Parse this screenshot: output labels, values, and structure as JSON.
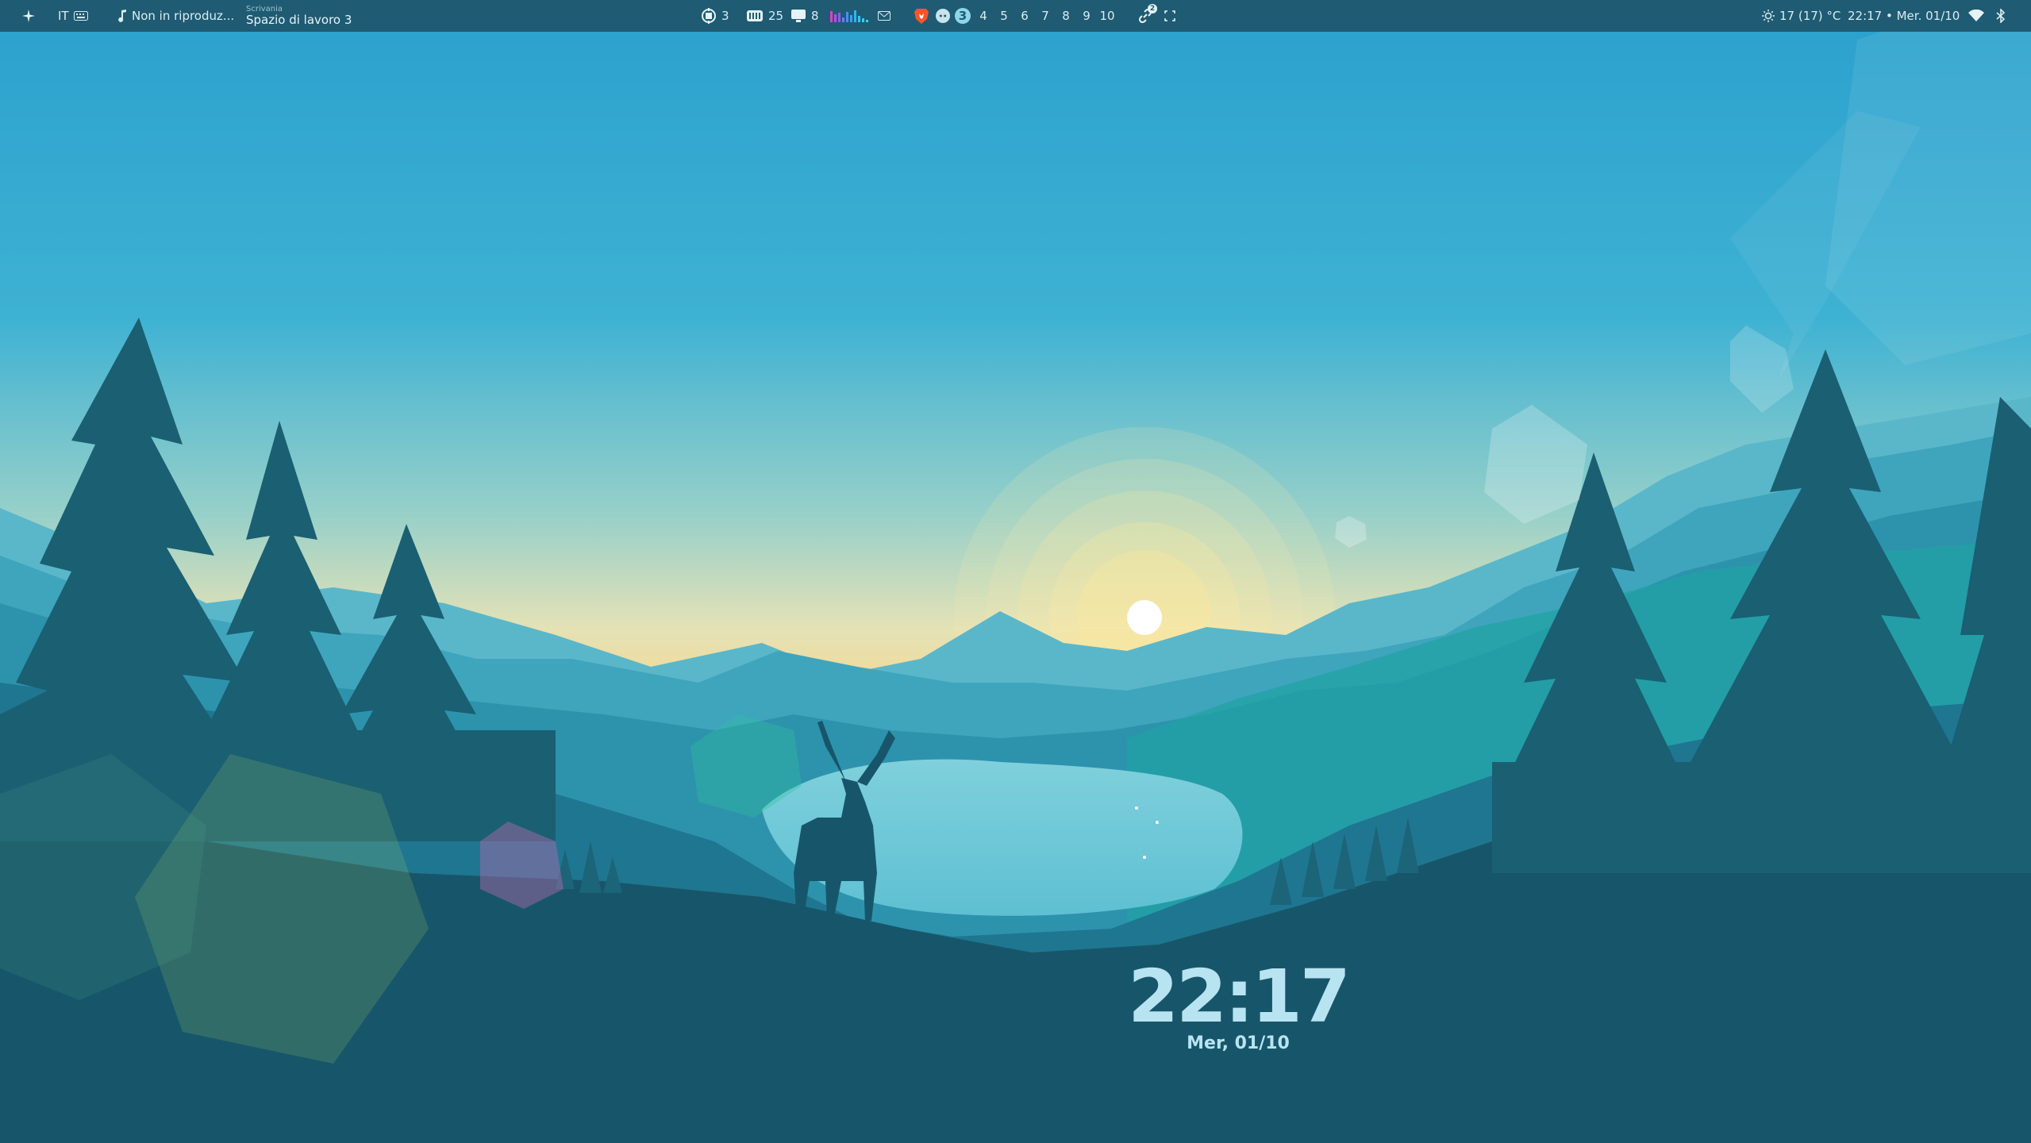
{
  "topbar": {
    "launcher_icon": "sparkle-icon",
    "keyboard_layout": "IT",
    "keyboard_icon": "keyboard-icon",
    "media_icon": "music-note-icon",
    "media_status": "Non in riproduz...",
    "workspace": {
      "caption": "Scrivania",
      "name": "Spazio di lavoro 3"
    },
    "stats": {
      "cpu_icon": "cpu-icon",
      "cpu_value": "3",
      "ram_icon": "memory-icon",
      "ram_value": "25",
      "gpu_icon": "monitor-icon",
      "gpu_value": "8",
      "visualizer_icon": "audio-visualizer-icon",
      "mail_icon": "mail-icon"
    },
    "apps": {
      "browser_icon": "brave-browser-icon",
      "chat_icon": "discord-icon"
    },
    "workspaces": {
      "active": "3",
      "items": [
        "4",
        "5",
        "6",
        "7",
        "8",
        "9",
        "10"
      ]
    },
    "notifications": {
      "icon": "link-notification-icon",
      "badge": "2"
    },
    "screenshot_icon": "screenshot-icon",
    "weather": {
      "icon": "sun-icon",
      "text": "17 (17) °C"
    },
    "datetime": "22:17 • Mer. 01/10",
    "wifi_icon": "wifi-icon",
    "bluetooth_icon": "bluetooth-icon"
  },
  "desktop": {
    "clock_time": "22:17",
    "clock_date": "Mer, 01/10"
  },
  "colors": {
    "bar_bg": "#1f5b73",
    "sky_top": "#2ba3cf",
    "sky_horizon": "#f2dc9a",
    "foreground_hill": "#17566a",
    "accent": "#8fd6e8"
  }
}
